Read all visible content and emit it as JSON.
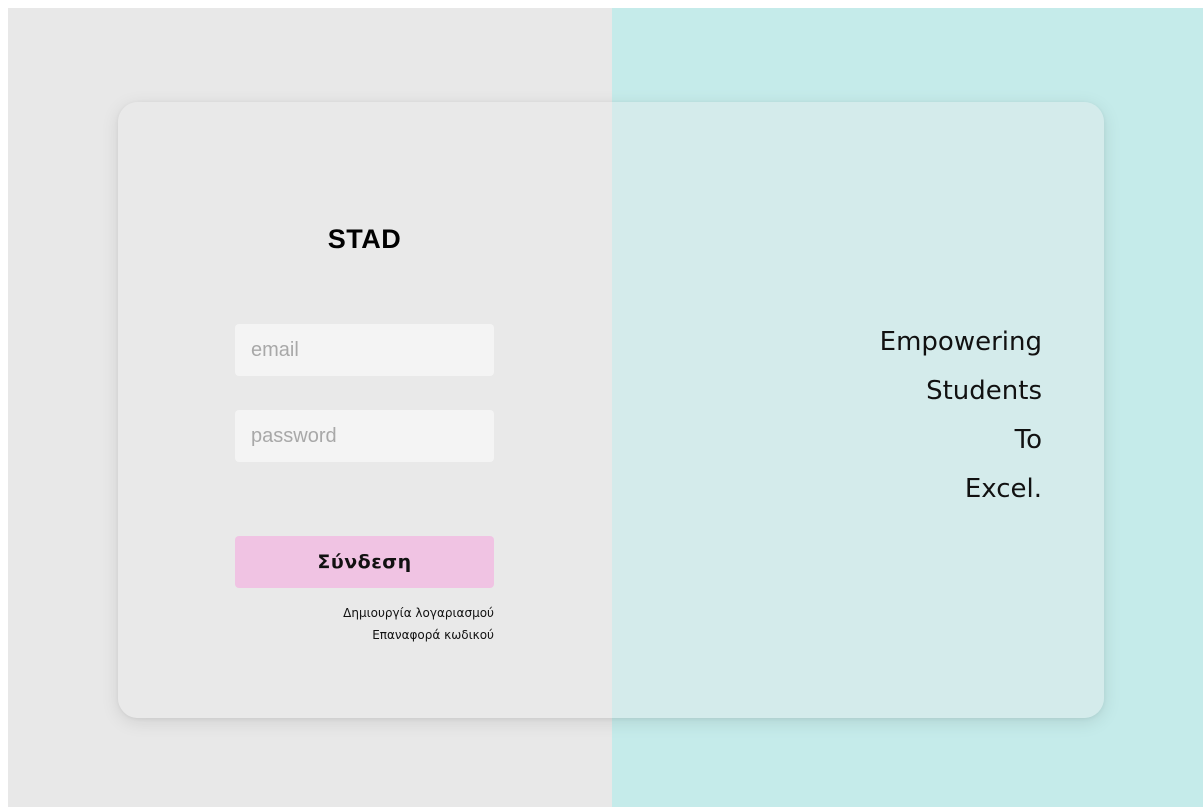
{
  "brand": {
    "title": "STAD"
  },
  "login_form": {
    "email_placeholder": "email",
    "email_value": "",
    "password_placeholder": "password",
    "password_value": "",
    "submit_label": "Σύνδεση",
    "create_account_link": "Δημιουργία λογαριασμού",
    "reset_password_link": "Επαναφορά κωδικού"
  },
  "tagline": {
    "lines": [
      "Empowering",
      "Students",
      "To",
      "Excel."
    ]
  },
  "colors": {
    "left_background": "#e8e8e8",
    "right_background": "#c5ebea",
    "card_left": "#e9e9e9",
    "card_right": "#d4ebeb",
    "input_background": "#f4f4f4",
    "button_background": "#f0c3e3"
  }
}
